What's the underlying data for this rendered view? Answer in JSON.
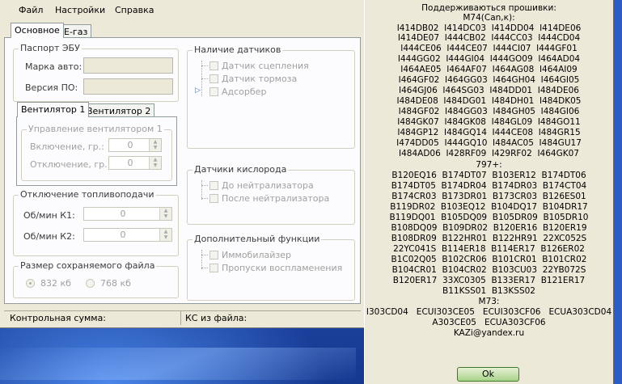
{
  "menu": [
    "Файл",
    "Настройки",
    "Справка"
  ],
  "tabs": {
    "main": "Основное",
    "egas": "E-газ"
  },
  "passport": {
    "title": "Паспорт ЭБУ",
    "make_label": "Марка авто:",
    "make_value": "",
    "version_label": "Версия ПО:",
    "version_value": ""
  },
  "fan_tabs": {
    "fan1": "Вентилятор 1",
    "fan2": "Вентилятор 2"
  },
  "fan_control": {
    "title": "Управление вентилятором 1",
    "on_label": "Включение, гр.:",
    "on_value": "0",
    "off_label": "Отключение, гр.:",
    "off_value": "0"
  },
  "fuel_cut": {
    "title": "Отключение топливоподачи",
    "k1_label": "Об/мин К1:",
    "k1_value": "0",
    "k2_label": "Об/мин К2:",
    "k2_value": "0"
  },
  "file_size": {
    "title": "Размер сохраняемого файла",
    "opt1": "832 кб",
    "opt2": "768 кб"
  },
  "sensors": {
    "title": "Наличие датчиков",
    "items": [
      "Датчик сцепления",
      "Датчик тормоза",
      "Адсорбер"
    ]
  },
  "o2_sensors": {
    "title": "Датчики кислорода",
    "items": [
      "До нейтрализатора",
      "После нейтрализатора"
    ]
  },
  "extra": {
    "title": "Дополнительный функции",
    "items": [
      "Иммобилайзер",
      "Пропуски воспламенения"
    ]
  },
  "status": {
    "checksum": "Контрольная сумма:",
    "ks_file": "КС из файла:"
  },
  "info": {
    "lines": [
      "Поддерживаються прошивки:",
      "M74(Can,к):",
      "I414DB02  I414DC03  I414DD04  I414DE06",
      "I414DE07  I444CB02  I444CC03  I444CD04",
      "I444CE06  I444CE07  I444CI07  I444GF01",
      "I444GG02  I444GI04  I444GO09  I464AD04",
      "I464AE05  I464AF07  I464AG08  I464AI09",
      "I464GF02  I464GG03  I464GH04  I464GI05",
      "I464GJ06  I464SG03  I484DD01  I484DE06",
      "I484DE08  I484DG01  I484DH01  I484DK05",
      "I484GF02  I484GG03  I484GH05  I484GI06",
      "I484GK07  I484GK08  I484GL09  I484GO11",
      "I484GP12  I484GQ14  I444CE08  I484GR15",
      "I474DD05  I444GQ10  I484AC05  I484GU17",
      "I484AD06  I428RF09  I429RF02  I464GK07",
      "797+:",
      "B120EQ16  B174DT07  B103ER12  B174DT06",
      "B174DT05  B174DR04  B174DR03  B174CT04",
      "B174CR03  B173DR01  B173CR03  B126ES01",
      "B119DR02  B103EQ12  B104DQ17  B104DR17",
      "B119DQ01  B105DQ09  B105DR09  B105DR10",
      "B108DQ09  B109DR02  B120ER16  B120ER19",
      "B108DR09  B122HR01  B122HR91  22XC052S",
      "22YC041S  B114ER18  B114ER17  B126ER02",
      "B1C02Q05  B102CR06  B101CR01  B101CR02",
      "B104CR01  B104CR02  B103CU03  22YB072S",
      "B120ER17  33XC0305  B133ER17  B121ER17",
      "B11KSS01  B13KSS02",
      "M73:",
      "I303CD04   ECUI303CE05   ECUI303CF06   ECUA303CD04",
      "A303CE05   ECUA303CF06",
      "KAZi@yandex.ru"
    ],
    "ok": "Ok"
  }
}
